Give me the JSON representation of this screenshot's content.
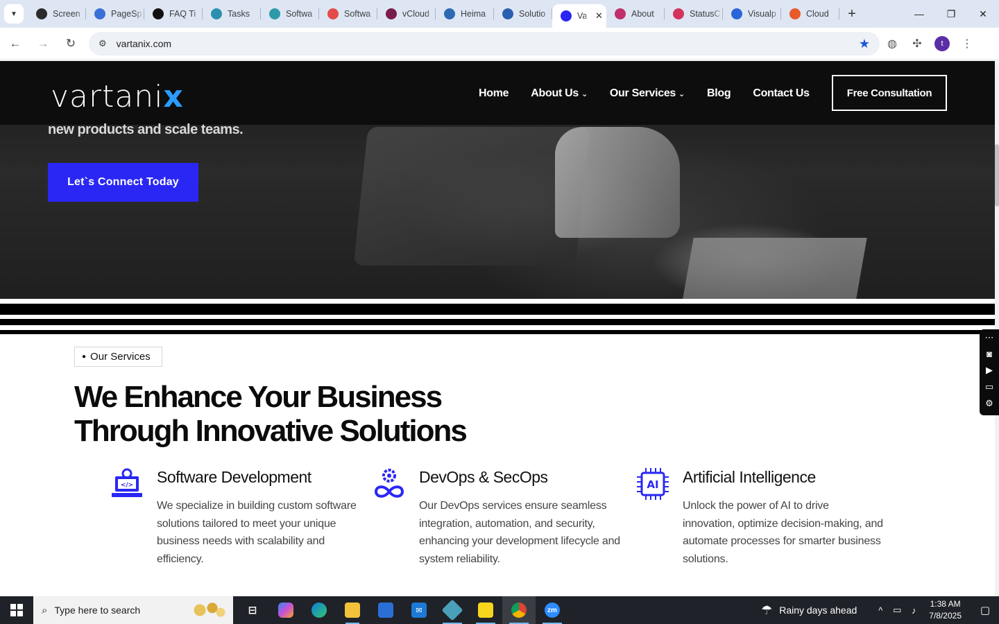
{
  "browser": {
    "tabs": [
      {
        "label": "Screen",
        "color": "#2b2b2b"
      },
      {
        "label": "PageSp",
        "color": "#3b6fd8"
      },
      {
        "label": "FAQ Ti",
        "color": "#111111"
      },
      {
        "label": "Tasks",
        "color": "#2c8fb0"
      },
      {
        "label": "Softwa",
        "color": "#2c9aa8"
      },
      {
        "label": "Softwa",
        "color": "#e34b4b"
      },
      {
        "label": "vCloud",
        "color": "#7a1d4a"
      },
      {
        "label": "Heima",
        "color": "#2d6ab3"
      },
      {
        "label": "Solutio",
        "color": "#2a5fb0"
      },
      {
        "label": "Va",
        "color": "#2a27f5",
        "active": true
      },
      {
        "label": "About",
        "color": "#c0306a"
      },
      {
        "label": "StatusC",
        "color": "#d4335e"
      },
      {
        "label": "Visualp",
        "color": "#2a66d8"
      },
      {
        "label": "Cloud",
        "color": "#e85a2a"
      }
    ],
    "url": "vartanix.com",
    "profile_initial": "t"
  },
  "site": {
    "logo_text": "vartani",
    "logo_x": "x",
    "menu": {
      "home": "Home",
      "about": "About Us",
      "services": "Our Services",
      "blog": "Blog",
      "contact": "Contact Us"
    },
    "cta_outline": "Free Consultation",
    "hero_tagline": "new products and scale teams.",
    "hero_button": "Let`s Connect Today",
    "services_tag": "Our Services",
    "headline_line1": "We Enhance Your Business",
    "headline_line2": "Through Innovative Solutions",
    "cards": [
      {
        "title": "Software Development",
        "desc": "We specialize in building custom software solutions tailored to meet your unique business needs with scalability and efficiency."
      },
      {
        "title": "DevOps & SecOps",
        "desc": "Our DevOps services ensure seamless integration, automation, and security, enhancing your development lifecycle and system reliability."
      },
      {
        "title": "Artificial Intelligence",
        "desc": "Unlock the power of AI to drive innovation, optimize decision-making, and automate processes for smarter business solutions."
      }
    ],
    "accent": "#2a27f5"
  },
  "taskbar": {
    "search_placeholder": "Type here to search",
    "weather": "Rainy days ahead",
    "time": "1:38 AM",
    "date": "7/8/2025"
  }
}
